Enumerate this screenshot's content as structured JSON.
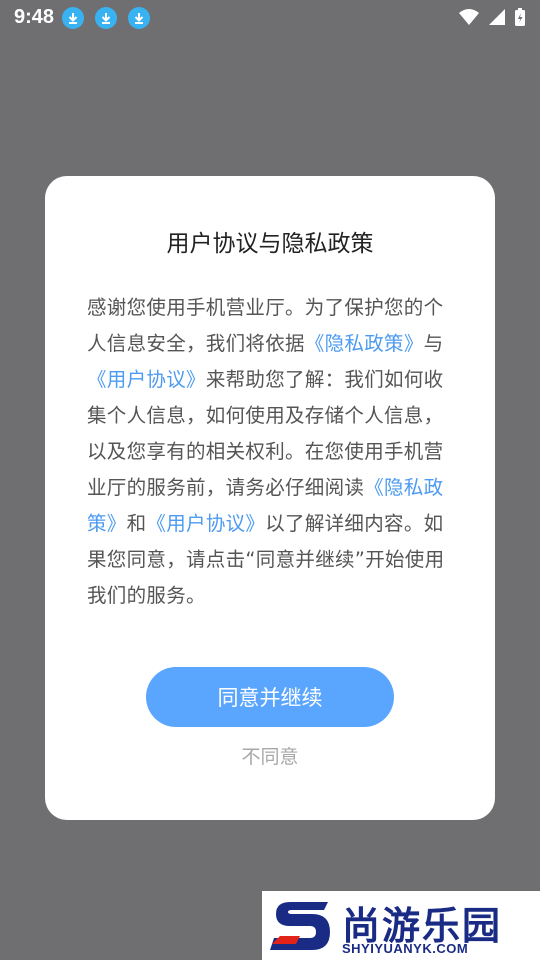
{
  "status_bar": {
    "time": "9:48",
    "notification_icons": [
      "download-icon",
      "download-icon",
      "download-icon"
    ],
    "right_icons": [
      "wifi-icon",
      "signal-icon",
      "battery-charging-icon"
    ]
  },
  "dialog": {
    "title": "用户协议与隐私政策",
    "body": {
      "part1": "感谢您使用手机营业厅。为了保护您的个人信息安全，我们将依据",
      "link_privacy_1": "《隐私政策》",
      "part2": "与",
      "link_user_1": "《用户协议》",
      "part3": "来帮助您了解：我们如何收集个人信息，如何使用及存储个人信息，以及您享有的相关权利。在您使用手机营业厅的服务前，请务必仔细阅读",
      "link_privacy_2": "《隐私政策》",
      "part4": "和",
      "link_user_2": "《用户协议》",
      "part5": "以了解详细内容。如果您同意，请点击“同意并继续”开始使用我们的服务。"
    },
    "agree_label": "同意并继续",
    "disagree_label": "不同意"
  },
  "watermark": {
    "name": "尚游乐园",
    "url": "SHYIYUANYK.COM"
  },
  "colors": {
    "overlay": "#6f6f72",
    "accent": "#5aa6ff",
    "link": "#4d9bf0",
    "watermark": "#1a2b85"
  }
}
